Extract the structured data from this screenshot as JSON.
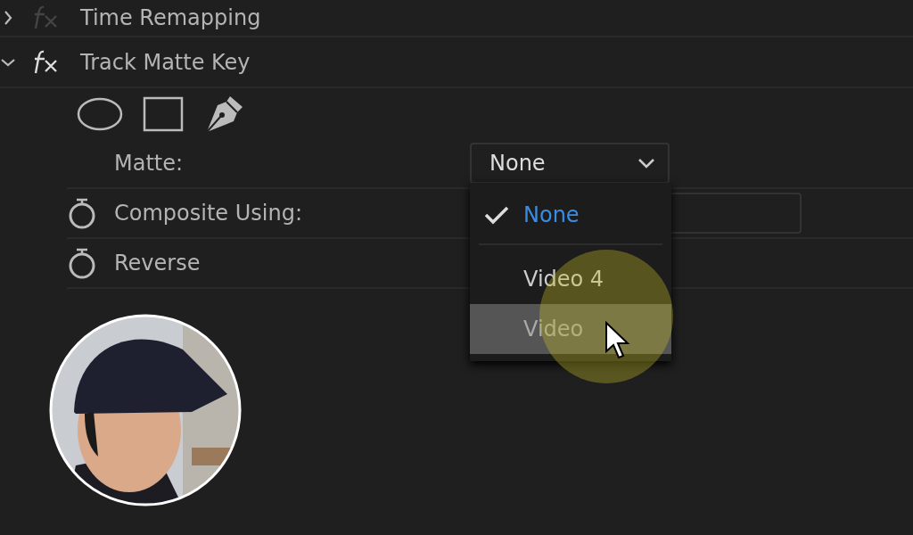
{
  "effects": [
    {
      "name": "Time Remapping",
      "expanded": false,
      "enabled": false
    },
    {
      "name": "Track Matte Key",
      "expanded": true,
      "enabled": true
    }
  ],
  "properties": [
    {
      "kind": "dropdown",
      "label": "Matte:",
      "value": "None",
      "stopwatch": false
    },
    {
      "kind": "dropdown",
      "label": "Composite Using:",
      "stopwatch": true
    },
    {
      "kind": "plain",
      "label": "Reverse",
      "stopwatch": true
    }
  ],
  "menu": {
    "items": [
      {
        "label": "None",
        "selected": true,
        "hovered": false
      },
      {
        "label": "Video 4",
        "selected": false,
        "hovered": false
      },
      {
        "label": "Video",
        "selected": false,
        "hovered": true
      }
    ]
  }
}
